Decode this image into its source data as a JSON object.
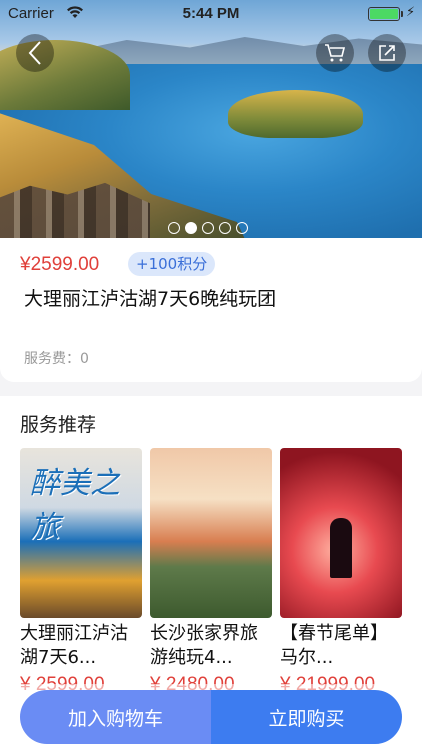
{
  "status_bar": {
    "carrier": "Carrier",
    "time": "5:44 PM"
  },
  "hero": {
    "carousel_count": 5,
    "active_index": 1
  },
  "product": {
    "price": "¥2599.00",
    "points": "+100积分",
    "title": "大理丽江泸沽湖7天6晚纯玩团",
    "fee": "服务费：0"
  },
  "recommend": {
    "heading": "服务推荐",
    "items": [
      {
        "name": "大理丽江泸沽湖7天6...",
        "price": "¥ 2599.00",
        "badge": "醉美之旅"
      },
      {
        "name": "长沙张家界旅游纯玩4...",
        "price": "¥ 2480.00"
      },
      {
        "name": "【春节尾单】马尔...",
        "price": "¥ 21999.00"
      }
    ]
  },
  "actions": {
    "add_cart": "加入购物车",
    "buy_now": "立即购买"
  },
  "colors": {
    "price_red": "#e0403a",
    "primary_blue": "#3d7cf0",
    "secondary_blue": "#6a8cf4",
    "points_bg": "#dbe7fb"
  }
}
